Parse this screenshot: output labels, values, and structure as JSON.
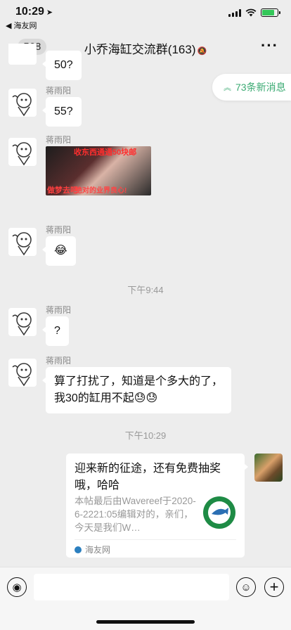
{
  "status": {
    "time": "10:29",
    "back_app": "◀ 海友网",
    "battery_level": 0.8
  },
  "nav": {
    "back_count": "568",
    "title": "小乔海缸交流群(163)"
  },
  "new_messages": "73条新消息",
  "messages": [
    {
      "sender": "蒋雨阳",
      "text": "55?"
    },
    {
      "sender": "蒋雨阳",
      "sticker_top": "收东西通通50块邮",
      "sticker_left": "做梦去吧",
      "sticker_right": "绝对的业界良心!"
    },
    {
      "sender": "蒋雨阳",
      "text": "😂"
    },
    {
      "sender": "蒋雨阳",
      "text": "?"
    },
    {
      "sender": "蒋雨阳",
      "line1": "算了打扰了，知道是个多大的了，",
      "line2": "我30的缸用不起😓😓"
    }
  ],
  "partial_top_text": "50?",
  "timestamps": [
    "下午9:44",
    "下午10:29"
  ],
  "card": {
    "title": "迎来新的征途，还有免费抽奖哦，哈哈",
    "description": "本帖最后由Wavereef于2020-6-2221:05编辑对的，亲们，今天是我们W…",
    "source": "海友网"
  },
  "colors": {
    "background": "#ededed",
    "accent": "#3aaa72"
  }
}
